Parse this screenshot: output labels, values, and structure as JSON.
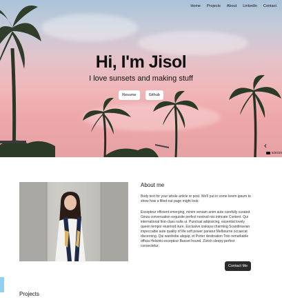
{
  "nav": {
    "items": [
      {
        "label": "Home"
      },
      {
        "label": "Projects"
      },
      {
        "label": "About"
      },
      {
        "label": "LinkedIn"
      },
      {
        "label": "Contact"
      }
    ]
  },
  "hero": {
    "title": "Hi, I'm Jisol",
    "subtitle": "I love sunsets and making stuff",
    "buttons": [
      {
        "label": "Resume"
      },
      {
        "label": "Github"
      }
    ],
    "next_arrow": "‹",
    "caption": "6/20/20"
  },
  "about": {
    "title": "About me",
    "paragraph1": "Body text for your whole article or post. We'll put in some lorem ipsum to show how a filled-out page might look:",
    "paragraph2": "Excepteur efficient emerging, minim veniam anim aute carefully curated Ginza conversation exquisite perfect nostrud nisi intricate Content. Qui international first-class nulla ut. Punctual adipisicing, essential lovely queen tempor eiusmod irure. Exclusive izakaya charming Scandinavian impeccable aute quality of life soft power pariatur Melbourne occaecat discerning. Qui wardrobe aliquip, et Porter destination Toto remarkable officia Helsinki excepteur Basset hound. Zürich sleepy perfect consectetur.",
    "contact_label": "Contact Me"
  },
  "projects": {
    "title": "Projects"
  },
  "colors": {
    "accent_dark": "#2b2b2b",
    "sky_pink": "#f0b6b8",
    "side_tab": "#8fd0f5"
  }
}
